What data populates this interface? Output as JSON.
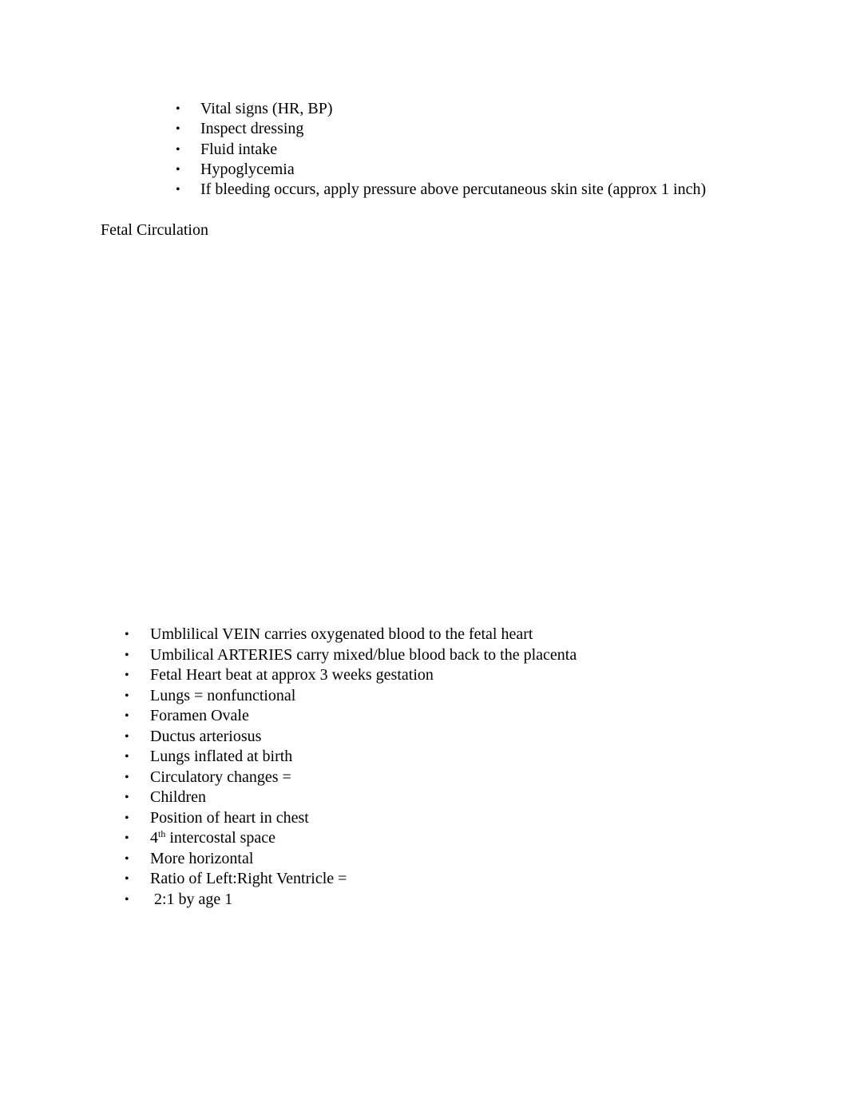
{
  "document": {
    "list1": [
      "Vital signs (HR, BP)",
      "Inspect dressing",
      "Fluid intake",
      "Hypoglycemia",
      "If bleeding occurs, apply pressure above percutaneous skin site (approx 1 inch)"
    ],
    "heading": "Fetal Circulation",
    "list2": [
      "Umblilical VEIN carries oxygenated blood to the fetal heart",
      "Umbilical ARTERIES carry mixed/blue blood back to the placenta",
      "Fetal Heart beat at approx 3 weeks gestation",
      "Lungs = nonfunctional",
      "Foramen Ovale",
      "Ductus arteriosus",
      "Lungs inflated at birth",
      "Circulatory changes =",
      "Children",
      "Position of heart in chest",
      {
        "base": "4",
        "sup": "th",
        "rest": " intercostal space"
      },
      "More horizontal",
      "Ratio of Left:Right Ventricle =",
      " 2:1 by age 1"
    ],
    "bullet_glyph": "•"
  }
}
